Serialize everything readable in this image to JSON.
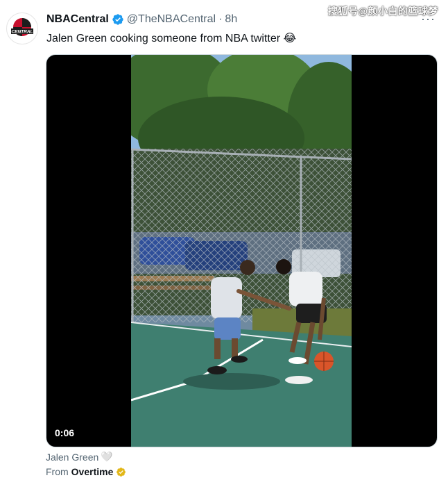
{
  "watermark": "搜狐号@颜小白的篮球梦",
  "tweet": {
    "display_name": "NBACentral",
    "handle": "@TheNBACentral",
    "separator": "·",
    "time": "8h",
    "text": "Jalen Green cooking someone from NBA twitter 😂",
    "more_label": "···"
  },
  "media": {
    "duration": "0:06"
  },
  "caption": {
    "text": "Jalen Green",
    "emoji": "🤍"
  },
  "source": {
    "prefix": "From",
    "name": "Overtime"
  },
  "avatar": {
    "label": "CENTRAL"
  },
  "colors": {
    "verified_blue": "#1d9bf0",
    "gold_badge": "#e2b719",
    "court_green": "#3f7f70",
    "avatar_red": "#c8102e"
  }
}
